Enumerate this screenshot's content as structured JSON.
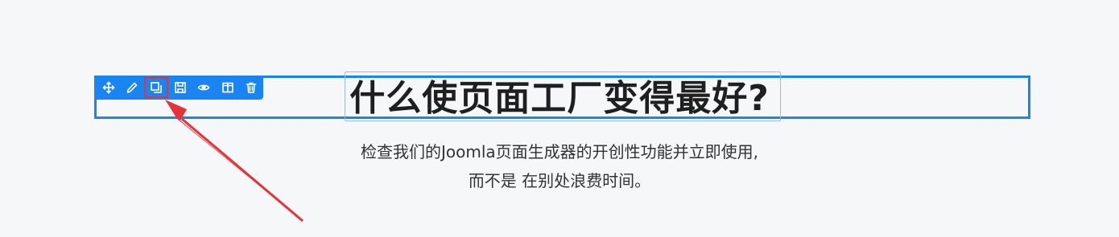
{
  "heading": {
    "text": "什么使页面工厂变得最好?"
  },
  "description": {
    "line1": "检查我们的Joomla页面生成器的开创性功能并立即使用,",
    "line2": "而不是 在别处浪费时间。"
  },
  "toolbar": {
    "buttons": [
      {
        "icon": "move-icon"
      },
      {
        "icon": "pencil-icon"
      },
      {
        "icon": "duplicate-icon",
        "highlighted": true
      },
      {
        "icon": "save-icon"
      },
      {
        "icon": "eye-icon"
      },
      {
        "icon": "columns-icon"
      },
      {
        "icon": "trash-icon"
      }
    ]
  },
  "colors": {
    "accent": "#1a84f0",
    "highlight": "#e5333a",
    "annotation_arrow": "#e5333a",
    "background": "#f6f7f9"
  }
}
